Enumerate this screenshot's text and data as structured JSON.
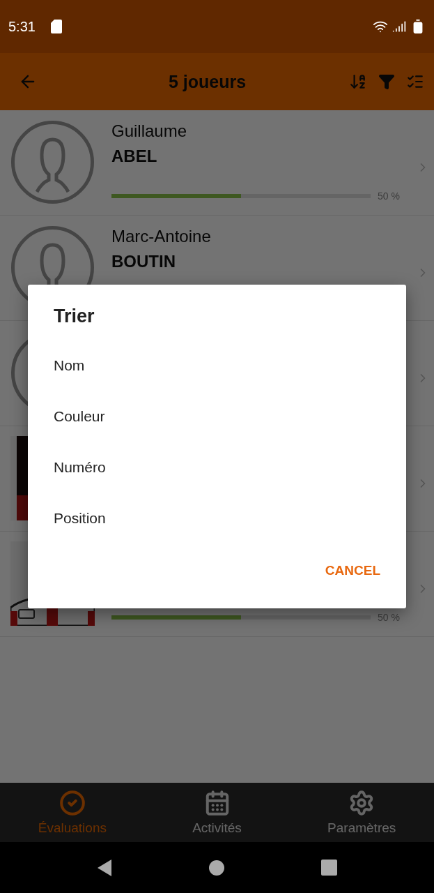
{
  "status_bar": {
    "time": "5:31"
  },
  "app_bar": {
    "title": "5 joueurs"
  },
  "players": [
    {
      "kind": "avatar",
      "first_name": "Guillaume",
      "last_name": "ABEL",
      "progress": {
        "level": 0.5,
        "reading": "50 %"
      }
    },
    {
      "kind": "avatar",
      "first_name": "Marc-Antoine",
      "last_name": "BOUTIN"
    },
    {
      "kind": "avatar"
    },
    {
      "kind": "picture"
    },
    {
      "kind": "picture",
      "progress": {
        "level": 0.5,
        "reading": "50 %"
      }
    }
  ],
  "dialog": {
    "title": "Trier",
    "options": [
      "Nom",
      "Couleur",
      "Numéro",
      "Position"
    ],
    "cancel": "CANCEL"
  },
  "bottom_nav": [
    {
      "label": "Évaluations",
      "selected": true
    },
    {
      "label": "Activités",
      "selected": false
    },
    {
      "label": "Paramètres",
      "selected": false
    }
  ]
}
